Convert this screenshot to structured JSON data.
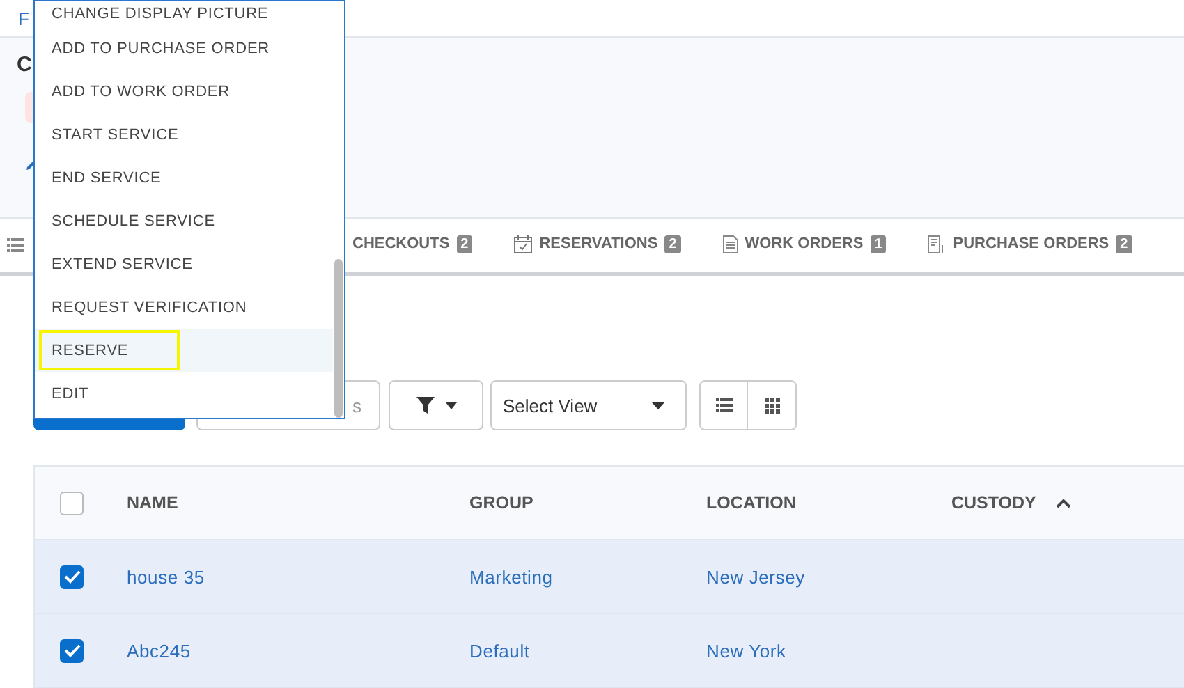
{
  "breadcrumb": {
    "text": "F"
  },
  "header": {
    "title": "C"
  },
  "tabs": [
    {
      "label": "CHECKOUTS",
      "count": "2",
      "selected": false
    },
    {
      "label": "RESERVATIONS",
      "count": "2",
      "selected": false
    },
    {
      "label": "WORK ORDERS",
      "count": "1",
      "selected": false
    },
    {
      "label": "PURCHASE ORDERS",
      "count": "2",
      "selected": false
    }
  ],
  "toolbar": {
    "search": {
      "placeholder": "s"
    },
    "view_select": {
      "value": "Select View"
    }
  },
  "table": {
    "columns": [
      {
        "label": "NAME",
        "sorted": false
      },
      {
        "label": "GROUP",
        "sorted": false
      },
      {
        "label": "LOCATION",
        "sorted": false
      },
      {
        "label": "CUSTODY",
        "sorted": true
      }
    ],
    "header_checked": false,
    "rows": [
      {
        "checked": true,
        "cells": [
          "house 35",
          "Marketing",
          "New Jersey"
        ]
      },
      {
        "checked": true,
        "cells": [
          "Abc245",
          "Default",
          "New York"
        ]
      }
    ]
  },
  "menu": {
    "items": [
      {
        "label": "CHANGE DISPLAY PICTURE",
        "selected": false,
        "highlighted": false
      },
      {
        "label": "ADD TO PURCHASE ORDER",
        "selected": false,
        "highlighted": false
      },
      {
        "label": "ADD TO WORK ORDER",
        "selected": false,
        "highlighted": false
      },
      {
        "label": "START SERVICE",
        "selected": false,
        "highlighted": false
      },
      {
        "label": "END SERVICE",
        "selected": false,
        "highlighted": false
      },
      {
        "label": "SCHEDULE SERVICE",
        "selected": false,
        "highlighted": false
      },
      {
        "label": "EXTEND SERVICE",
        "selected": false,
        "highlighted": false
      },
      {
        "label": "REQUEST VERIFICATION",
        "selected": false,
        "highlighted": false
      },
      {
        "label": "RESERVE",
        "selected": true,
        "highlighted": true
      },
      {
        "label": "EDIT",
        "selected": false,
        "highlighted": false
      }
    ]
  }
}
